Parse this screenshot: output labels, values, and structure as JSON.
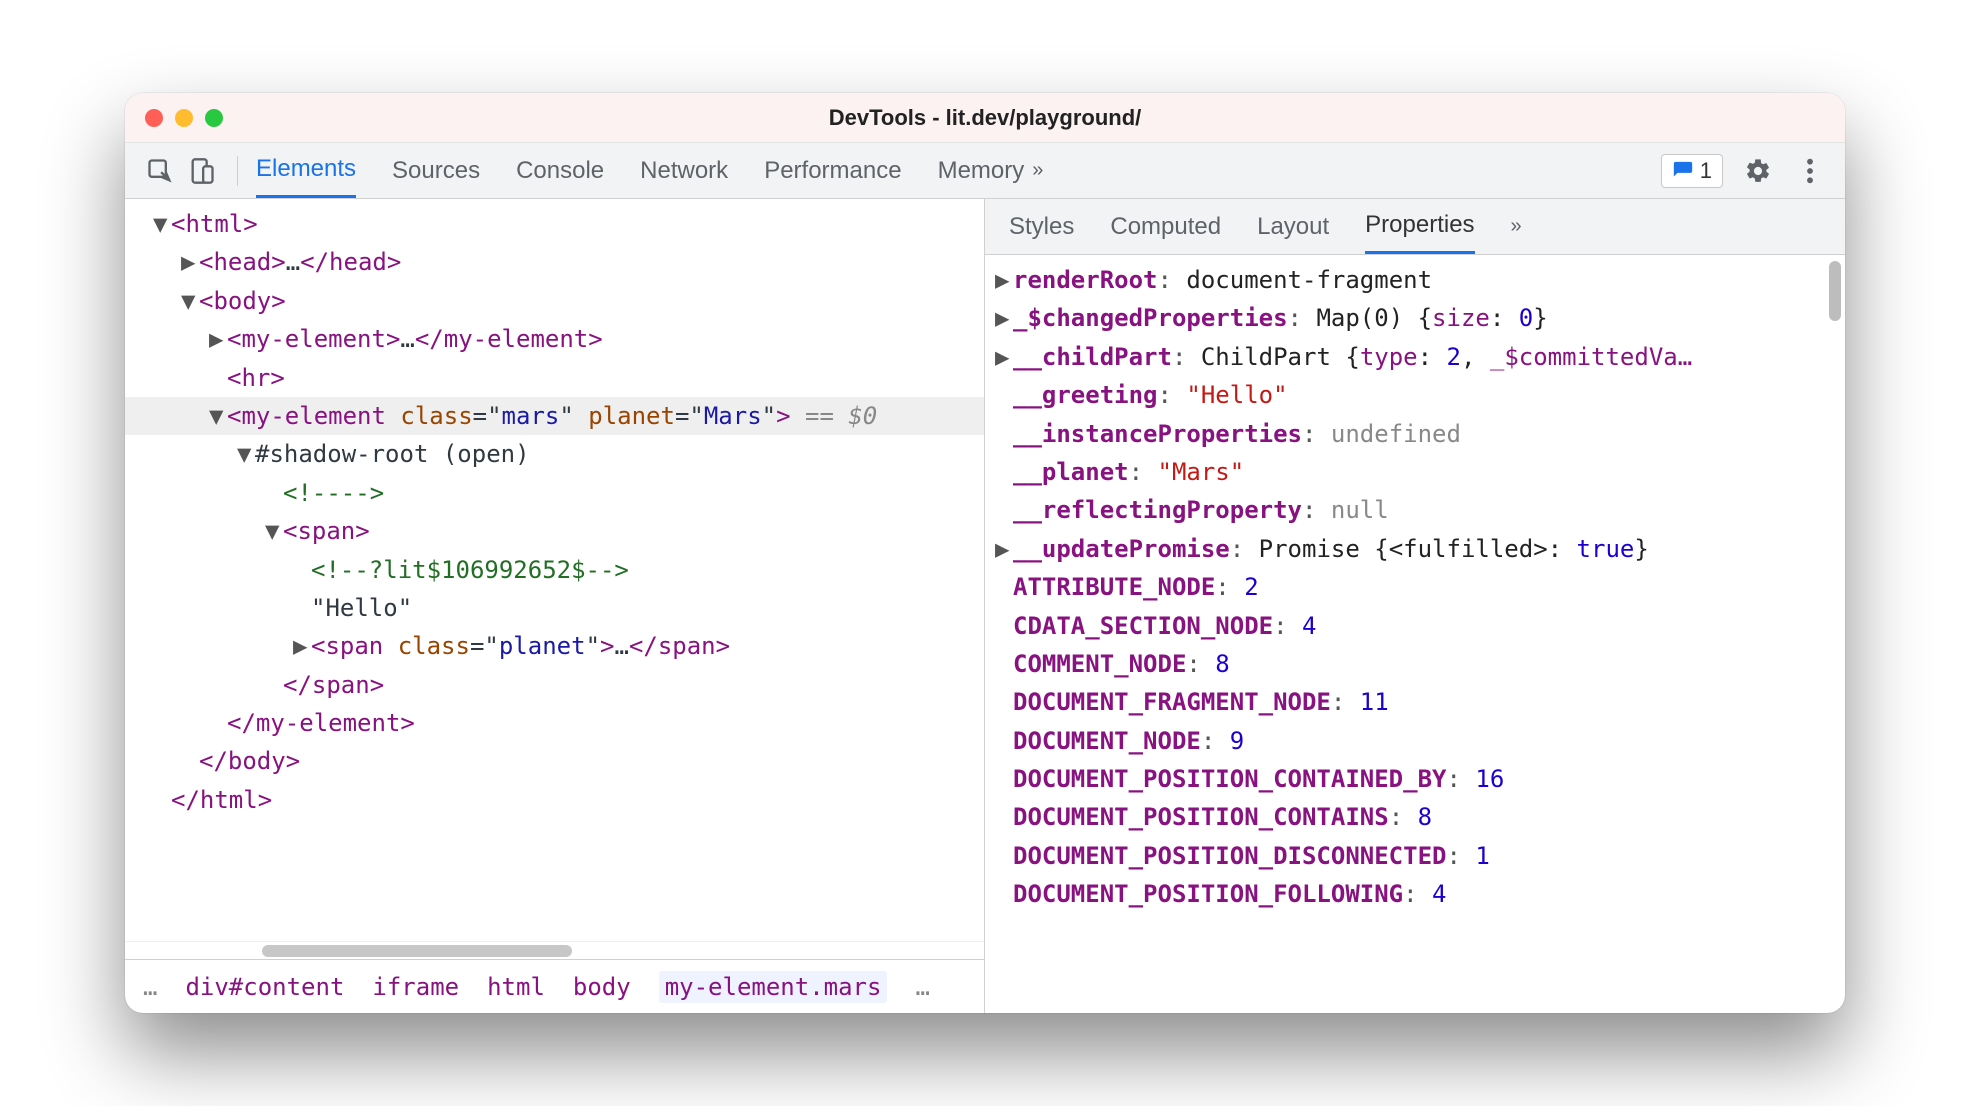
{
  "window": {
    "title": "DevTools - lit.dev/playground/"
  },
  "toolbar": {
    "tabs": [
      "Elements",
      "Sources",
      "Console",
      "Network",
      "Performance",
      "Memory"
    ],
    "active_tab": "Elements",
    "issues_count": "1"
  },
  "dom": {
    "lines": [
      {
        "indent": 1,
        "caret": "▼",
        "html": [
          {
            "t": "tag",
            "v": "<html>"
          }
        ]
      },
      {
        "indent": 2,
        "caret": "▶",
        "html": [
          {
            "t": "tag",
            "v": "<head>"
          },
          {
            "t": "txt",
            "v": "…"
          },
          {
            "t": "tag",
            "v": "</head>"
          }
        ]
      },
      {
        "indent": 2,
        "caret": "▼",
        "html": [
          {
            "t": "tag",
            "v": "<body>"
          }
        ]
      },
      {
        "indent": 3,
        "caret": "▶",
        "html": [
          {
            "t": "tag",
            "v": "<my-element>"
          },
          {
            "t": "txt",
            "v": "…"
          },
          {
            "t": "tag",
            "v": "</my-element>"
          }
        ]
      },
      {
        "indent": 3,
        "caret": "",
        "html": [
          {
            "t": "tag",
            "v": "<hr>"
          }
        ]
      },
      {
        "indent": 3,
        "caret": "▼",
        "sel": true,
        "html": [
          {
            "t": "tag",
            "v": "<my-element "
          },
          {
            "t": "attr",
            "v": "class"
          },
          {
            "t": "txt",
            "v": "=\""
          },
          {
            "t": "val",
            "v": "mars"
          },
          {
            "t": "txt",
            "v": "\" "
          },
          {
            "t": "attr",
            "v": "planet"
          },
          {
            "t": "txt",
            "v": "=\""
          },
          {
            "t": "val",
            "v": "Mars"
          },
          {
            "t": "txt",
            "v": "\""
          },
          {
            "t": "tag",
            "v": ">"
          },
          {
            "t": "gray",
            "v": " == $0"
          }
        ]
      },
      {
        "indent": 4,
        "caret": "▼",
        "html": [
          {
            "t": "txt",
            "v": "#shadow-root (open)"
          }
        ]
      },
      {
        "indent": 5,
        "caret": "",
        "html": [
          {
            "t": "comment",
            "v": "<!---->"
          }
        ]
      },
      {
        "indent": 5,
        "caret": "▼",
        "html": [
          {
            "t": "tag",
            "v": "<span>"
          }
        ]
      },
      {
        "indent": 6,
        "caret": "",
        "html": [
          {
            "t": "comment",
            "v": "<!--?lit$106992652$-->"
          }
        ]
      },
      {
        "indent": 6,
        "caret": "",
        "html": [
          {
            "t": "txt",
            "v": "\"Hello\""
          }
        ]
      },
      {
        "indent": 6,
        "caret": "▶",
        "html": [
          {
            "t": "tag",
            "v": "<span "
          },
          {
            "t": "attr",
            "v": "class"
          },
          {
            "t": "txt",
            "v": "=\""
          },
          {
            "t": "val",
            "v": "planet"
          },
          {
            "t": "txt",
            "v": "\""
          },
          {
            "t": "tag",
            "v": ">"
          },
          {
            "t": "txt",
            "v": "…"
          },
          {
            "t": "tag",
            "v": "</span>"
          }
        ]
      },
      {
        "indent": 5,
        "caret": "",
        "html": [
          {
            "t": "tag",
            "v": "</span>"
          }
        ]
      },
      {
        "indent": 3,
        "caret": "",
        "html": [
          {
            "t": "tag",
            "v": "</my-element>"
          }
        ]
      },
      {
        "indent": 2,
        "caret": "",
        "html": [
          {
            "t": "tag",
            "v": "</body>"
          }
        ]
      },
      {
        "indent": 1,
        "caret": "",
        "html": [
          {
            "t": "tag",
            "v": "</html>"
          }
        ]
      }
    ]
  },
  "breadcrumb": {
    "items": [
      "…",
      "div#content",
      "iframe",
      "html",
      "body",
      "my-element.mars",
      "…"
    ],
    "selected": "my-element.mars"
  },
  "subtabs": {
    "items": [
      "Styles",
      "Computed",
      "Layout",
      "Properties"
    ],
    "active": "Properties"
  },
  "properties": [
    {
      "exp": "▶",
      "key": "renderRoot",
      "keyBold": true,
      "sep": ": ",
      "val": [
        {
          "t": "obj",
          "v": "document-fragment"
        }
      ]
    },
    {
      "exp": "▶",
      "key": "_$changedProperties",
      "keyBold": true,
      "sep": ": ",
      "val": [
        {
          "t": "obj",
          "v": "Map(0) {"
        },
        {
          "t": "key",
          "v": "size"
        },
        {
          "t": "obj",
          "v": ": "
        },
        {
          "t": "num",
          "v": "0"
        },
        {
          "t": "obj",
          "v": "}"
        }
      ]
    },
    {
      "exp": "▶",
      "key": "__childPart",
      "keyBold": true,
      "sep": ": ",
      "val": [
        {
          "t": "obj",
          "v": "ChildPart {"
        },
        {
          "t": "key",
          "v": "type"
        },
        {
          "t": "obj",
          "v": ": "
        },
        {
          "t": "num",
          "v": "2"
        },
        {
          "t": "obj",
          "v": ", "
        },
        {
          "t": "key",
          "v": "_$committedVa…"
        }
      ]
    },
    {
      "exp": "",
      "key": "__greeting",
      "keyBold": true,
      "sep": ": ",
      "val": [
        {
          "t": "str",
          "v": "\"Hello\""
        }
      ]
    },
    {
      "exp": "",
      "key": "__instanceProperties",
      "keyBold": true,
      "sep": ": ",
      "val": [
        {
          "t": "gray",
          "v": "undefined"
        }
      ]
    },
    {
      "exp": "",
      "key": "__planet",
      "keyBold": true,
      "sep": ": ",
      "val": [
        {
          "t": "str",
          "v": "\"Mars\""
        }
      ]
    },
    {
      "exp": "",
      "key": "__reflectingProperty",
      "keyBold": true,
      "sep": ": ",
      "val": [
        {
          "t": "gray",
          "v": "null"
        }
      ]
    },
    {
      "exp": "▶",
      "key": "__updatePromise",
      "keyBold": true,
      "sep": ": ",
      "val": [
        {
          "t": "obj",
          "v": "Promise {<fulfilled>: "
        },
        {
          "t": "bool",
          "v": "true"
        },
        {
          "t": "obj",
          "v": "}"
        }
      ]
    },
    {
      "exp": "",
      "key": "ATTRIBUTE_NODE",
      "sep": ": ",
      "val": [
        {
          "t": "num",
          "v": "2"
        }
      ]
    },
    {
      "exp": "",
      "key": "CDATA_SECTION_NODE",
      "sep": ": ",
      "val": [
        {
          "t": "num",
          "v": "4"
        }
      ]
    },
    {
      "exp": "",
      "key": "COMMENT_NODE",
      "sep": ": ",
      "val": [
        {
          "t": "num",
          "v": "8"
        }
      ]
    },
    {
      "exp": "",
      "key": "DOCUMENT_FRAGMENT_NODE",
      "sep": ": ",
      "val": [
        {
          "t": "num",
          "v": "11"
        }
      ]
    },
    {
      "exp": "",
      "key": "DOCUMENT_NODE",
      "sep": ": ",
      "val": [
        {
          "t": "num",
          "v": "9"
        }
      ]
    },
    {
      "exp": "",
      "key": "DOCUMENT_POSITION_CONTAINED_BY",
      "sep": ": ",
      "val": [
        {
          "t": "num",
          "v": "16"
        }
      ]
    },
    {
      "exp": "",
      "key": "DOCUMENT_POSITION_CONTAINS",
      "sep": ": ",
      "val": [
        {
          "t": "num",
          "v": "8"
        }
      ]
    },
    {
      "exp": "",
      "key": "DOCUMENT_POSITION_DISCONNECTED",
      "sep": ": ",
      "val": [
        {
          "t": "num",
          "v": "1"
        }
      ]
    },
    {
      "exp": "",
      "key": "DOCUMENT_POSITION_FOLLOWING",
      "sep": ": ",
      "val": [
        {
          "t": "num",
          "v": "4"
        }
      ]
    }
  ]
}
